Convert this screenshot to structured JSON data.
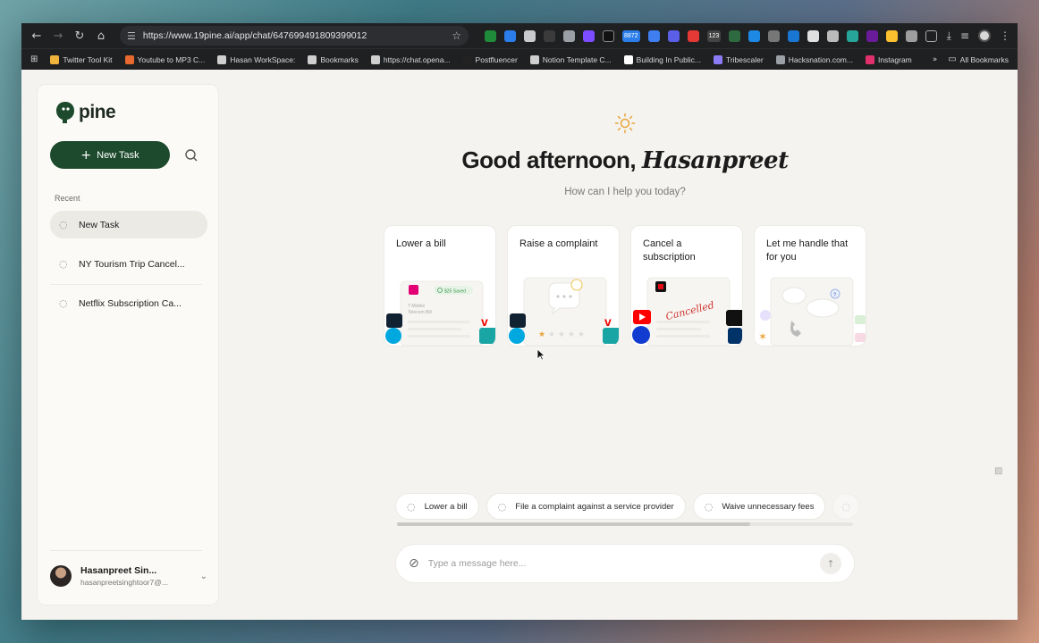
{
  "browser": {
    "url": "https://www.19pine.ai/app/chat/647699491809399012",
    "bookmarks": [
      {
        "label": "Twitter Tool Kit",
        "color": "#f0b43c"
      },
      {
        "label": "Youtube to MP3 C...",
        "color": "#e8692f"
      },
      {
        "label": "Hasan WorkSpace:",
        "color": "#cfcfcf"
      },
      {
        "label": "Bookmarks",
        "color": "#cfcfcf"
      },
      {
        "label": "https://chat.opena...",
        "color": "#cfcfcf"
      },
      {
        "label": "Postfluencer",
        "color": "#222222"
      },
      {
        "label": "Notion Template C...",
        "color": "#cfcfcf"
      },
      {
        "label": "Building In Public...",
        "color": "#ffffff"
      },
      {
        "label": "Tribescaler",
        "color": "#8b7cf6"
      },
      {
        "label": "Hacksnation.com...",
        "color": "#9aa0a6"
      },
      {
        "label": "Instagram",
        "color": "#e1306c"
      }
    ],
    "all_bookmarks": "All Bookmarks",
    "extension_badge_1": "8872",
    "extension_badge_2": "123"
  },
  "sidebar": {
    "logo_text": "pine",
    "new_task_label": "New Task",
    "recent_label": "Recent",
    "items": [
      {
        "label": "New Task",
        "active": true
      },
      {
        "label": "NY Tourism Trip Cancel...",
        "active": false
      },
      {
        "label": "Netflix Subscription Ca...",
        "active": false
      }
    ],
    "user": {
      "name": "Hasanpreet Sin...",
      "email": "hasanpreetsinghtoor7@..."
    }
  },
  "main": {
    "greeting_prefix": "Good afternoon, ",
    "greeting_name": "Hasanpreet",
    "subtitle": "How can I help you today?",
    "cards": [
      {
        "title": "Lower a bill",
        "badge": "$25 Saved",
        "mini_text_1": "T-Mobile",
        "mini_text_2": "Telecom Bill"
      },
      {
        "title": "Raise a complaint"
      },
      {
        "title": "Cancel a subscription",
        "stamp": "Cancelled"
      },
      {
        "title": "Let me handle that for you"
      }
    ],
    "chips": [
      {
        "label": "Lower a bill"
      },
      {
        "label": "File a complaint against a service provider"
      },
      {
        "label": "Waive unnecessary fees"
      }
    ],
    "composer_placeholder": "Type a message here..."
  },
  "colors": {
    "brand_green": "#1d4a2c",
    "sun": "#e8a53a"
  }
}
